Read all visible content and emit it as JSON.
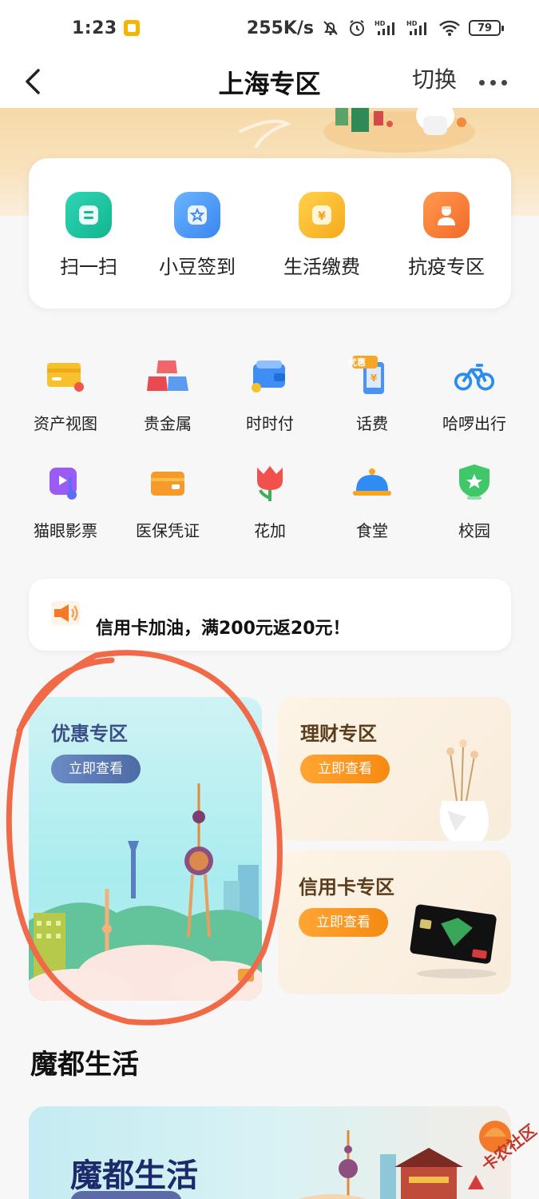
{
  "status_bar": {
    "time": "1:23",
    "speed": "255K/s",
    "battery": "79"
  },
  "nav": {
    "title": "上海专区",
    "switch_label": "切换"
  },
  "quick_actions": [
    {
      "label": "扫一扫",
      "icon": "scan-icon",
      "color": "#1ec8a6"
    },
    {
      "label": "小豆签到",
      "icon": "star-checkin-icon",
      "color": "#3d8ff0"
    },
    {
      "label": "生活缴费",
      "icon": "yuan-icon",
      "color": "#f7b52c"
    },
    {
      "label": "抗疫专区",
      "icon": "person-icon",
      "color": "#f3762e"
    }
  ],
  "grid": [
    {
      "label": "资产视图",
      "icon": "asset-card-icon"
    },
    {
      "label": "贵金属",
      "icon": "gold-bars-icon"
    },
    {
      "label": "时时付",
      "icon": "wallet-icon"
    },
    {
      "label": "话费",
      "icon": "phone-bill-icon",
      "badge": "优惠"
    },
    {
      "label": "哈啰出行",
      "icon": "bicycle-icon"
    },
    {
      "label": "猫眼影票",
      "icon": "music-ticket-icon"
    },
    {
      "label": "医保凭证",
      "icon": "medical-card-icon"
    },
    {
      "label": "花加",
      "icon": "tulip-icon"
    },
    {
      "label": "食堂",
      "icon": "food-cloche-icon"
    },
    {
      "label": "校园",
      "icon": "campus-shield-icon"
    }
  ],
  "notice": {
    "text": "信用卡加油，满200元返20元！"
  },
  "zones": {
    "discount": {
      "title": "优惠专区",
      "button": "立即查看"
    },
    "finance": {
      "title": "理财专区",
      "button": "立即查看"
    },
    "credit": {
      "title": "信用卡专区",
      "button": "立即查看"
    }
  },
  "section": {
    "title": "魔都生活",
    "banner_title": "魔都生活"
  },
  "watermark": "卡农社区",
  "colors": {
    "accent_orange": "#f79a1e",
    "annotation_red": "#f06a48",
    "discount_btn": "#5a7bb0"
  }
}
